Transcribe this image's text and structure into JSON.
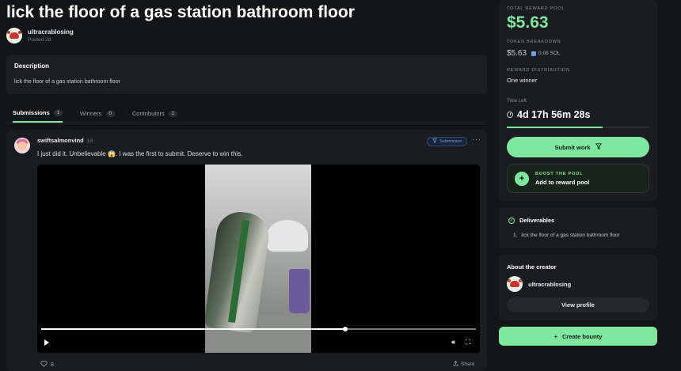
{
  "bounty": {
    "title": "lick the floor of a gas station bathroom floor",
    "author": "ultracrablosing",
    "posted": "Posted 2d"
  },
  "description": {
    "label": "Description",
    "text": "lick the floor of a gas station bathroom floor"
  },
  "tabs": [
    {
      "label": "Submissions",
      "count": "1"
    },
    {
      "label": "Winners",
      "count": "0"
    },
    {
      "label": "Contributors",
      "count": "1"
    }
  ],
  "submission": {
    "user": "swiftsalmonvind",
    "time": "1d",
    "badge": "Submission",
    "text": "I just did it. Unbelievable 😱. I was the first to submit. Deserve to win this.",
    "likes": "8",
    "share_label": "Share",
    "video": {
      "progress": 0.7
    }
  },
  "pool": {
    "total_label": "TOTAL REWARD POOL",
    "total": "$5.63",
    "token_label": "TOKEN BREAKDOWN",
    "token_amount": "$5.63",
    "token_sol": "0.08 SOL",
    "distribution_label": "REWARD DISTRIBUTION",
    "distribution": "One winner",
    "time_label": "Time Left",
    "time_left": "4d 17h 56m 28s",
    "time_progress": 0.67,
    "submit_label": "Submit work",
    "boost_label": "BOOST THE POOL",
    "boost_text": "Add to reward pool"
  },
  "deliverables": {
    "title": "Deliverables",
    "items": [
      "lick the floor of a gas station bathroom floor"
    ]
  },
  "creator": {
    "title": "About the creator",
    "name": "ultracrablosing",
    "view_label": "View profile"
  },
  "create_bounty_label": "Create bounty",
  "colors": {
    "accent": "#7ee8a0",
    "background": "#141517",
    "card": "#1b1c1f"
  },
  "icons": [
    "heart-icon",
    "share-icon",
    "play-icon",
    "volume-icon",
    "fullscreen-icon",
    "clock-icon",
    "plus-icon",
    "check-icon",
    "filter-icon",
    "more-icon"
  ]
}
